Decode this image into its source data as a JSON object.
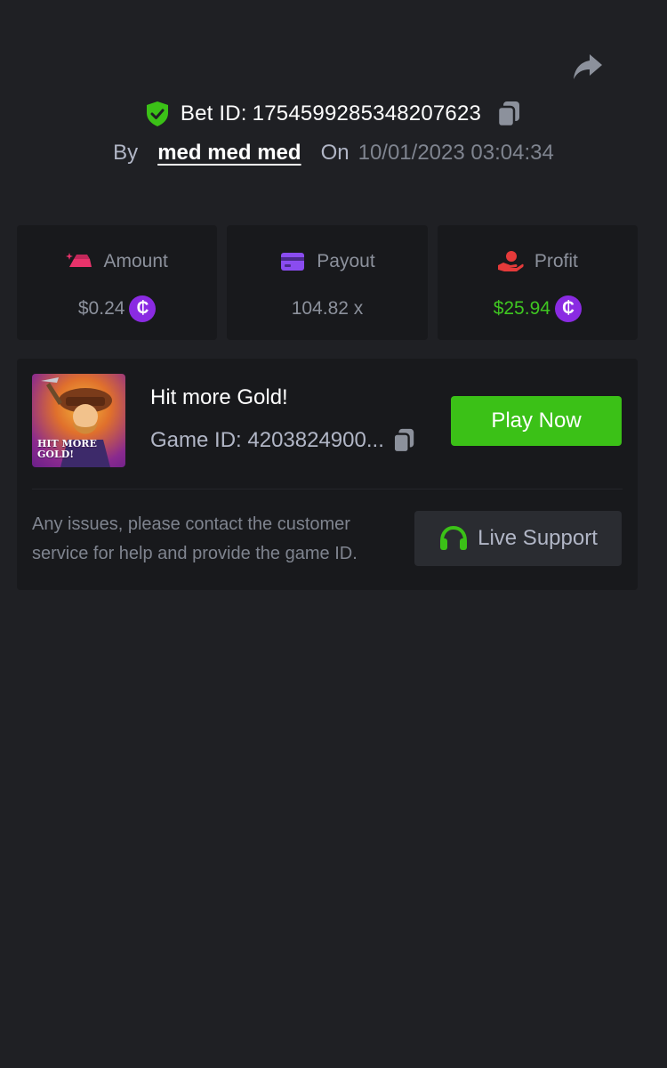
{
  "header": {
    "bet_label": "Bet ID:",
    "bet_id": "1754599285348207623",
    "by_label": "By",
    "username": "med med med",
    "on_label": "On",
    "datetime": "10/01/2023 03:04:34"
  },
  "stats": [
    {
      "label": "Amount",
      "value": "$0.24",
      "icon": "gold-bar-icon",
      "currency_icon": "coin-icon",
      "value_color": "#8c919c"
    },
    {
      "label": "Payout",
      "value": "104.82 x",
      "icon": "card-icon"
    },
    {
      "label": "Profit",
      "value": "$25.94",
      "icon": "hand-coin-icon",
      "currency_icon": "coin-icon",
      "value_color": "#3fc621"
    }
  ],
  "coin_symbol": "₵",
  "game": {
    "title": "Hit more Gold!",
    "id_label": "Game ID:",
    "id_value": "4203824900...",
    "thumbnail_text": "HIT MORE GOLD!",
    "play_label": "Play Now",
    "help_text": "Any issues, please contact the customer service for help and provide the game ID.",
    "support_label": "Live Support"
  },
  "colors": {
    "background": "#1f2024",
    "card": "#18191c",
    "accent_green": "#3bc117",
    "profit_green": "#3fc621",
    "coin_purple": "#8a2be2",
    "amount_pink": "#e8336b",
    "payout_purple": "#8a4cf0",
    "profit_red": "#e53a3a"
  }
}
